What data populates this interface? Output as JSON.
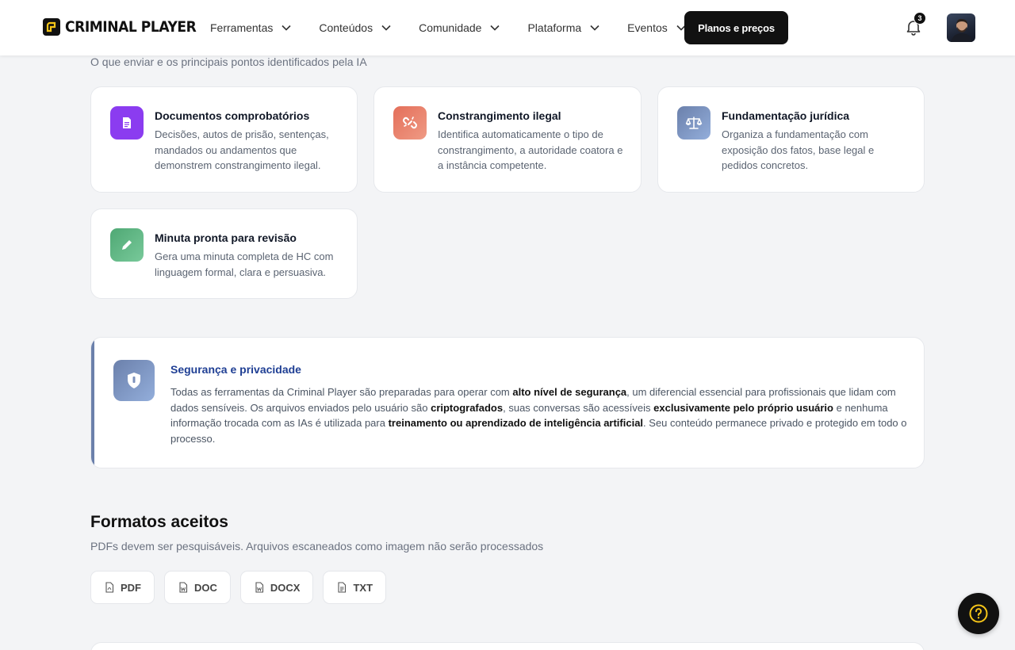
{
  "header": {
    "logo_text": "CRIMINAL PLAYER",
    "nav": [
      {
        "label": "Ferramentas"
      },
      {
        "label": "Conteúdos"
      },
      {
        "label": "Comunidade"
      },
      {
        "label": "Plataforma"
      },
      {
        "label": "Eventos"
      }
    ],
    "cta_label": "Planos e preços",
    "notification_count": "3",
    "icons": {
      "bell": "bell-icon",
      "chevron": "chevron-down-icon",
      "avatar": "user-avatar"
    }
  },
  "section": {
    "subtitle": "O que enviar e os principais pontos identificados pela IA",
    "cards": [
      {
        "title": "Documentos comprobatórios",
        "desc": "Decisões, autos de prisão, sentenças, mandados ou andamentos que demonstrem constrangimento ilegal.",
        "icon": "document-icon",
        "color": "#8b3cf0"
      },
      {
        "title": "Constrangimento ilegal",
        "desc": "Identifica automaticamente o tipo de constrangimento, a autoridade coatora e a instância competente.",
        "icon": "broken-link-icon",
        "color": "#e8806a"
      },
      {
        "title": "Fundamentação jurídica",
        "desc": "Organiza a fundamentação com exposição dos fatos, base legal e pedidos concretos.",
        "icon": "scales-icon",
        "color": "#7b90bb"
      },
      {
        "title": "Minuta pronta para revisão",
        "desc": "Gera uma minuta completa de HC com linguagem formal, clara e persuasiva.",
        "icon": "pencil-icon",
        "color": "#5fb584"
      }
    ]
  },
  "security": {
    "title": "Segurança e privacidade",
    "icon": "shield-icon",
    "parts": [
      {
        "text": "Todas as ferramentas da Criminal Player são preparadas para operar com ",
        "bold": false
      },
      {
        "text": "alto nível de segurança",
        "bold": true
      },
      {
        "text": ", um diferencial essencial para profissionais que lidam com dados sensíveis. Os arquivos enviados pelo usuário são ",
        "bold": false
      },
      {
        "text": "criptografados",
        "bold": true
      },
      {
        "text": ", suas conversas são acessíveis ",
        "bold": false
      },
      {
        "text": "exclusivamente pelo próprio usuário",
        "bold": true
      },
      {
        "text": " e nenhuma informação trocada com as IAs é utilizada para ",
        "bold": false
      },
      {
        "text": "treinamento ou aprendizado de inteligência artificial",
        "bold": true
      },
      {
        "text": ". Seu conteúdo permanece privado e protegido em todo o processo.",
        "bold": false
      }
    ]
  },
  "formats": {
    "title": "Formatos aceitos",
    "subtitle": "PDFs devem ser pesquisáveis. Arquivos escaneados como imagem não serão processados",
    "items": [
      {
        "label": "PDF",
        "icon": "pdf-file-icon"
      },
      {
        "label": "DOC",
        "icon": "word-file-icon"
      },
      {
        "label": "DOCX",
        "icon": "word-file-icon"
      },
      {
        "label": "TXT",
        "icon": "text-file-icon"
      }
    ]
  },
  "help": {
    "icon": "help-question-icon",
    "accent": "#f5c518"
  }
}
